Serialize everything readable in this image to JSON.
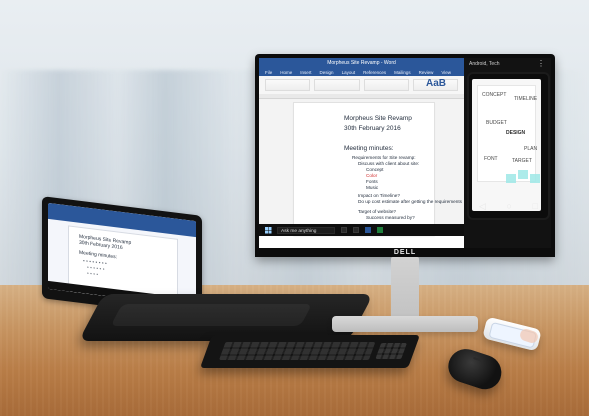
{
  "word": {
    "title": "Morpheus Site Revamp - Word",
    "menu": [
      "File",
      "Home",
      "Insert",
      "Design",
      "Layout",
      "References",
      "Mailings",
      "Review",
      "View"
    ],
    "ribbon_style_sample": "AaB",
    "doc": {
      "heading1": "Morpheus Site Revamp",
      "heading2": "30th February 2016",
      "meeting_title": "Meeting minutes:",
      "bullets": [
        "Requirements for Site revamp:",
        "Discuss with client about site:",
        "Concept",
        "Color",
        "Fonts",
        "Music",
        "Impact on Timeline?",
        "Do up cost estimate after getting the requirements",
        "Target of website?",
        "Success measured by?"
      ]
    },
    "taskbar_search_placeholder": "Ask me anything"
  },
  "continuum": {
    "title": "Android, Tech",
    "more": "⋮",
    "nav": {
      "back": "◁",
      "home": "○",
      "recent": "□"
    },
    "whiteboard_words": [
      "CONCEPT",
      "TIMELINE",
      "BUDGET",
      "DESIGN",
      "FONT",
      "TARGET",
      "PLAN"
    ]
  },
  "branding": {
    "monitor_logo": "DELL"
  },
  "laptop": {
    "doc_lines": [
      "Morpheus Site Revamp",
      "30th February 2016",
      "Meeting minutes:"
    ]
  }
}
